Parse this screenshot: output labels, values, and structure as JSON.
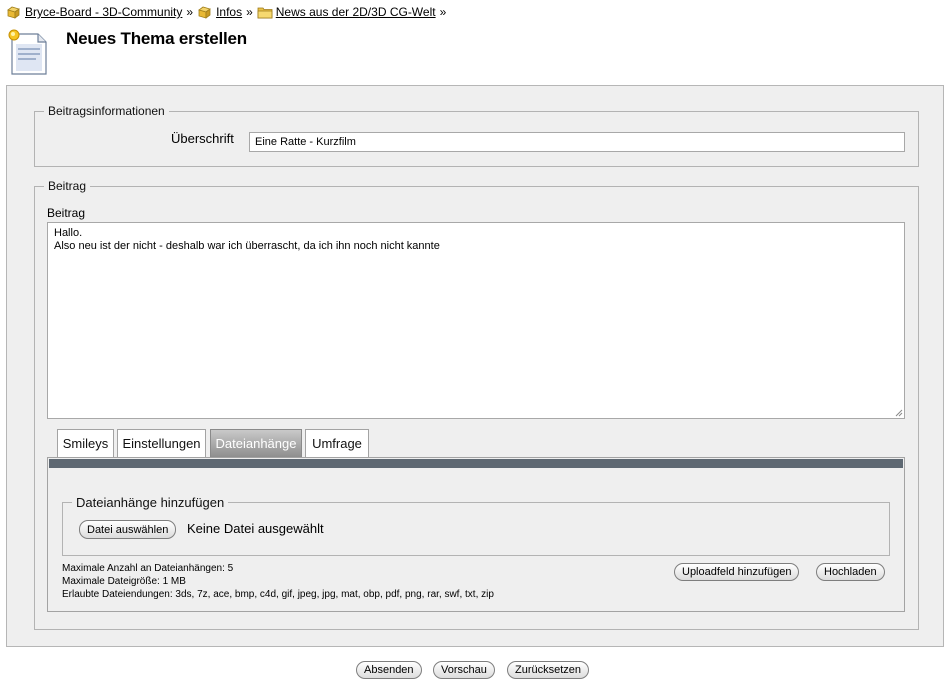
{
  "breadcrumb": [
    {
      "label": "Bryce-Board - 3D-Community",
      "icon": "folder-stack-icon"
    },
    {
      "label": "Infos",
      "icon": "folder-stack-icon"
    },
    {
      "label": "News aus der 2D/3D CG-Welt",
      "icon": "folder-icon"
    }
  ],
  "breadcrumb_separator": "»",
  "page": {
    "title": "Neues Thema erstellen",
    "icon": "new-document-icon"
  },
  "post_info": {
    "legend": "Beitragsinformationen",
    "subject_label": "Überschrift",
    "subject_value": "Eine Ratte - Kurzfilm"
  },
  "post": {
    "legend": "Beitrag",
    "label": "Beitrag",
    "text": "Hallo.\nAlso neu ist der nicht - deshalb war ich überrascht, da ich ihn noch nicht kannte"
  },
  "tabs": [
    {
      "label": "Smileys",
      "active": false
    },
    {
      "label": "Einstellungen",
      "active": false
    },
    {
      "label": "Dateianhänge",
      "active": true
    },
    {
      "label": "Umfrage",
      "active": false
    }
  ],
  "attachments": {
    "legend": "Dateianhänge hinzufügen",
    "choose_button": "Datei auswählen",
    "no_file_text": "Keine Datei ausgewählt",
    "max_count": "Maximale Anzahl an Dateianhängen: 5",
    "max_size": "Maximale Dateigröße: 1 MB",
    "allowed_ext": "Erlaubte Dateiendungen: 3ds, 7z, ace, bmp, c4d, gif, jpeg, jpg, mat, obp, pdf, png, rar, swf, txt, zip",
    "add_field_button": "Uploadfeld hinzufügen",
    "upload_button": "Hochladen"
  },
  "actions": {
    "submit": "Absenden",
    "preview": "Vorschau",
    "reset": "Zurücksetzen"
  },
  "colors": {
    "tab_bar": "#5e6872",
    "panel_bg": "#efefef",
    "active_tab": "#9a9a9a"
  }
}
